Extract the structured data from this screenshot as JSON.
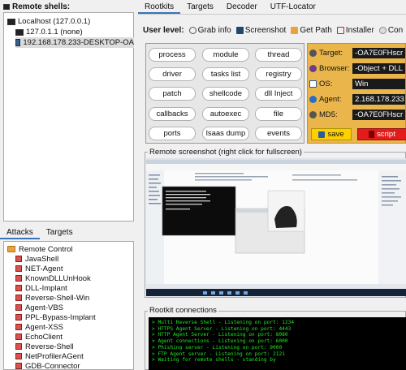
{
  "left": {
    "shells_title": "Remote shells:",
    "tree": [
      {
        "label": "Localhost (127.0.0.1)"
      },
      {
        "label": "127.0.1.1 (none)"
      },
      {
        "label": "192.168.178.233-DESKTOP-OA"
      }
    ],
    "tabs": [
      "Attacks",
      "Targets"
    ],
    "attacks_root": "Remote Control",
    "attacks": [
      "JavaShell",
      "NET-Agent",
      "KnownDLLUnHook",
      "DLL-Implant",
      "Reverse-Shell-Win",
      "Agent-VBS",
      "PPL-Bypass-Implant",
      "Agent-XSS",
      "EchoClient",
      "Reverse-Shell",
      "NetProfilerAGent",
      "GDB-Connector"
    ]
  },
  "tabs": [
    "Rootkits",
    "Targets",
    "Decoder",
    "UTF-Locator"
  ],
  "toolbar": {
    "label": "User level:",
    "buttons": [
      "Grab info",
      "Screenshot",
      "Get Path",
      "Installer",
      "Con"
    ]
  },
  "commands": [
    "process",
    "module",
    "thread",
    "driver",
    "tasks list",
    "registry",
    "patch",
    "shellcode",
    "dll Inject",
    "callbacks",
    "autoexec",
    "file",
    "ports",
    "lsaas dump",
    "events"
  ],
  "info": {
    "rows": [
      {
        "label": "Target:",
        "value": "-OA7E0FHscr",
        "icon": "target-icon"
      },
      {
        "label": "Browser:",
        "value": "-Object + DLL",
        "icon": "browser-icon"
      },
      {
        "label": "OS:",
        "value": "Win",
        "icon": "os-icon"
      },
      {
        "label": "Agent:",
        "value": "2.168.178.233",
        "icon": "agent-icon"
      },
      {
        "label": "MD5:",
        "value": "-OA7E0FHscr",
        "icon": "md5-icon"
      }
    ],
    "save_label": "save",
    "script_label": "script"
  },
  "screenshot_title": "Remote screenshot (right click for fullscreen)",
  "connections_title": "Rootkit connections",
  "console": [
    "> Multi Reverse Shell - Listening on port: 1234",
    "> HTTPS Agent Server - Listening on port: 4443",
    "> HTTP Agent Server - Listening on port: 8080",
    "> Agent connections - Listening on port: 6000",
    "> Phishing server - Listening on port: 9000",
    "> FTP Agent server - Listening on port: 2121",
    "",
    "> Waiting for remote shells - standing by"
  ],
  "colors": {
    "accent": "#3b73b9",
    "info_bg": "#eab64b",
    "console_text": "#22e522",
    "save": "#ffd000",
    "script": "#e21b1b"
  }
}
